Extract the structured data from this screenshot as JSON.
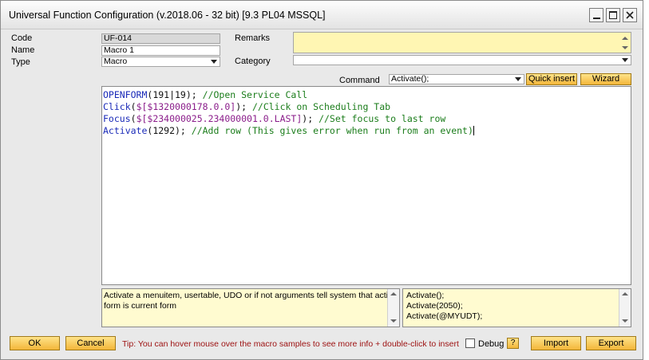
{
  "window": {
    "title": "Universal Function Configuration (v.2018.06 - 32 bit) [9.3 PL04 MSSQL]"
  },
  "header": {
    "code_label": "Code",
    "code_value": "UF-014",
    "name_label": "Name",
    "name_value": "Macro 1",
    "type_label": "Type",
    "type_value": "Macro",
    "remarks_label": "Remarks",
    "remarks_value": "",
    "category_label": "Category",
    "category_value": ""
  },
  "command": {
    "label": "Command",
    "value": "Activate();",
    "quick_insert_label": "Quick insert",
    "wizard_label": "Wizard"
  },
  "editor": {
    "lines": [
      [
        {
          "t": "OPENFORM",
          "c": "kw"
        },
        {
          "t": "(191|19); ",
          "c": "pl"
        },
        {
          "t": "//Open Service Call",
          "c": "cm"
        }
      ],
      [
        {
          "t": "Click",
          "c": "kw"
        },
        {
          "t": "(",
          "c": "pl"
        },
        {
          "t": "$[$1320000178.0.0]",
          "c": "str"
        },
        {
          "t": "); ",
          "c": "pl"
        },
        {
          "t": "//Click on Scheduling Tab",
          "c": "cm"
        }
      ],
      [
        {
          "t": "Focus",
          "c": "kw"
        },
        {
          "t": "(",
          "c": "pl"
        },
        {
          "t": "$[$234000025.234000001.0.LAST]",
          "c": "str"
        },
        {
          "t": "); ",
          "c": "pl"
        },
        {
          "t": "//Set focus to last row",
          "c": "cm"
        }
      ],
      [
        {
          "t": "Activate",
          "c": "kw"
        },
        {
          "t": "(1292); ",
          "c": "pl"
        },
        {
          "t": "//Add row (This gives error when run from an event)",
          "c": "cm"
        }
      ]
    ]
  },
  "info": {
    "description": "Activate a menuitem, usertable, UDO or if not arguments tell system that active form is current form"
  },
  "samples": {
    "items": [
      "Activate();",
      "Activate(2050);",
      "Activate(@MYUDT);"
    ]
  },
  "footer": {
    "ok_label": "OK",
    "cancel_label": "Cancel",
    "tip": "Tip: You can hover mouse over the macro samples to see more info + double-click to insert",
    "debug_label": "Debug",
    "help_label": "?",
    "import_label": "Import",
    "export_label": "Export"
  }
}
